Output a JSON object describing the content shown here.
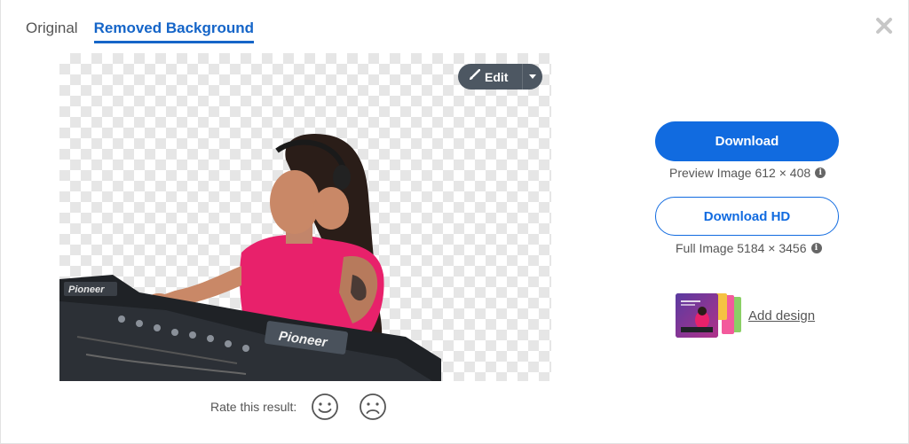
{
  "tabs": [
    {
      "label": "Original",
      "active": false
    },
    {
      "label": "Removed Background",
      "active": true
    }
  ],
  "editor": {
    "edit_label": "Edit"
  },
  "rating": {
    "label": "Rate this result:"
  },
  "download": {
    "button_label": "Download",
    "preview_info": "Preview Image 612 × 408",
    "hd_button_label": "Download HD",
    "full_info": "Full Image 5184 × 3456"
  },
  "add_design": {
    "label": "Add design"
  },
  "colors": {
    "accent": "#116be0",
    "tab_active": "#1565c8",
    "edit_bg": "#4d5762"
  },
  "icons": [
    "close-icon",
    "brush-icon",
    "caret-down-icon",
    "smile-icon",
    "frown-icon",
    "info-icon"
  ]
}
